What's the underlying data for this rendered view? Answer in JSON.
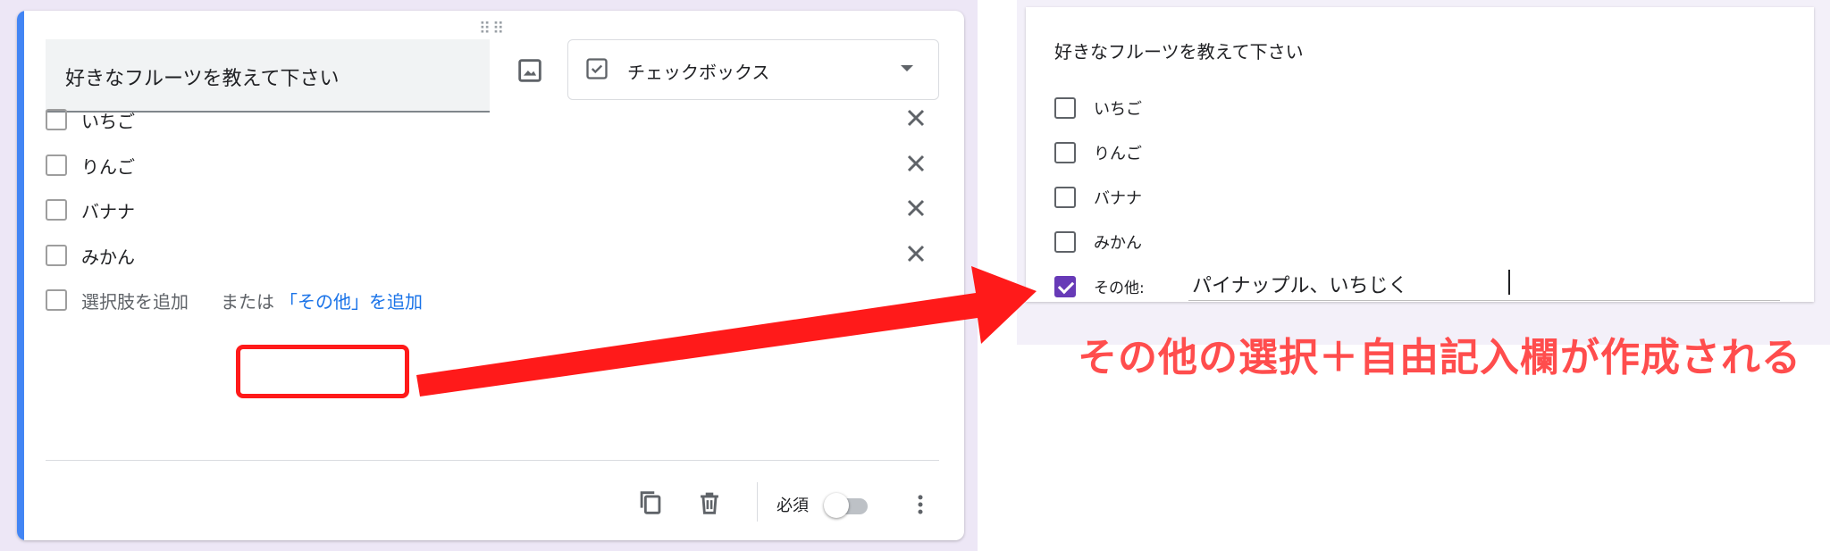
{
  "editor": {
    "question_title": "好きなフルーツを教えて下さい",
    "type_select_label": "チェックボックス",
    "options": [
      {
        "label": "いちご"
      },
      {
        "label": "りんご"
      },
      {
        "label": "バナナ"
      },
      {
        "label": "みかん"
      }
    ],
    "add_option_label": "選択肢を追加",
    "or_label": "または",
    "add_other_label": "「その他」を追加",
    "required_label": "必須",
    "required_on": false,
    "icons": {
      "drag": "drag-handle-icon",
      "image": "image-icon",
      "type": "checkbox-icon",
      "dropdown": "chevron-down-icon",
      "remove": "close-icon",
      "copy": "copy-icon",
      "delete": "trash-icon",
      "more": "more-vert-icon"
    }
  },
  "preview": {
    "question_title": "好きなフルーツを教えて下さい",
    "options": [
      {
        "label": "いちご",
        "checked": false
      },
      {
        "label": "りんご",
        "checked": false
      },
      {
        "label": "バナナ",
        "checked": false
      },
      {
        "label": "みかん",
        "checked": false
      }
    ],
    "other_label": "その他:",
    "other_checked": true,
    "other_value": "パイナップル、いちじく"
  },
  "caption": "その他の選択＋自由記入欄が作成される",
  "colors": {
    "accent_blue": "#4285f4",
    "link_blue": "#1a73e8",
    "highlight_red": "#ff1a1a",
    "caption_red": "#ff4d4d",
    "checkbox_purple": "#673ab7"
  }
}
